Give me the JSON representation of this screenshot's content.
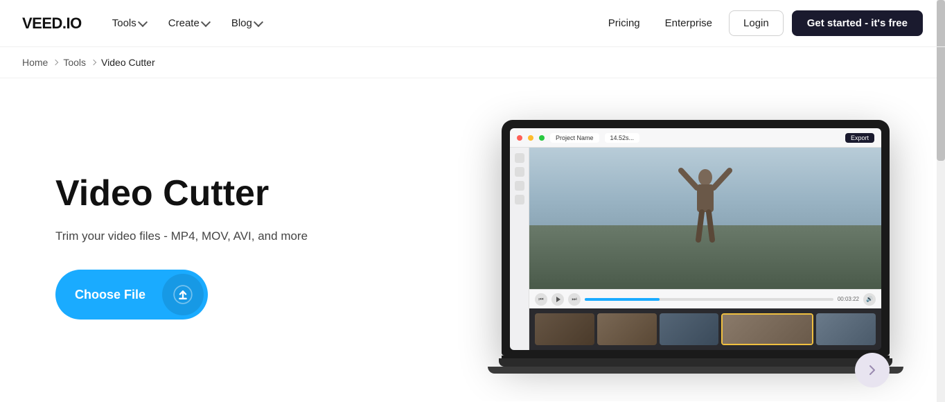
{
  "brand": {
    "logo": "VEED.IO"
  },
  "nav": {
    "tools_label": "Tools",
    "create_label": "Create",
    "blog_label": "Blog",
    "pricing_label": "Pricing",
    "enterprise_label": "Enterprise",
    "login_label": "Login",
    "cta_label": "Get started - it's free"
  },
  "breadcrumb": {
    "home": "Home",
    "tools": "Tools",
    "current": "Video Cutter"
  },
  "hero": {
    "title": "Video Cutter",
    "subtitle": "Trim your video files - MP4, MOV, AVI, and more",
    "cta_label": "Choose File"
  },
  "laptop": {
    "tab1": "Project Name",
    "tab2": "14.52s...",
    "export_btn": "Export"
  },
  "timeline": {
    "thumb_count": 5
  }
}
